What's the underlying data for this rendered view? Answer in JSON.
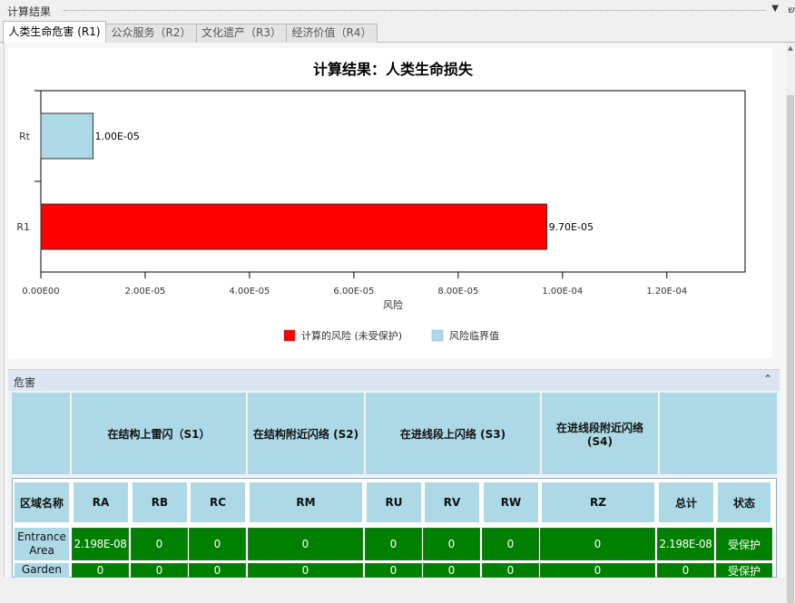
{
  "window": {
    "title": "计算结果"
  },
  "tabs": [
    {
      "label": "人类生命危害 (R1)",
      "active": true
    },
    {
      "label": "公众服务（R2）",
      "active": false
    },
    {
      "label": "文化遗产（R3）",
      "active": false
    },
    {
      "label": "经济价值（R4）",
      "active": false
    }
  ],
  "colors": {
    "calculated": "#ff0000",
    "tolerable": "#add8e6",
    "protected": "#008000",
    "header": "#add8e6"
  },
  "chart_data": {
    "type": "bar",
    "orientation": "horizontal",
    "title": "计算结果：人类生命损失",
    "xlabel": "风险",
    "ylabel": "",
    "categories": [
      "Rt",
      "R1"
    ],
    "bar_labels": [
      "1.00E-05",
      "9.70E-05"
    ],
    "xlim": [
      0,
      0.000135
    ],
    "xticks": [
      0,
      2e-05,
      4e-05,
      6e-05,
      8e-05,
      0.0001,
      0.00012
    ],
    "xtick_labels": [
      "0.00E00",
      "2.00E-05",
      "4.00E-05",
      "6.00E-05",
      "8.00E-05",
      "1.00E-04",
      "1.20E-04"
    ],
    "series": [
      {
        "name": "计算的风险 (未受保护)",
        "color": "#ff0000",
        "values": [
          null,
          9.7e-05
        ]
      },
      {
        "name": "风险临界值",
        "color": "#add8e6",
        "values": [
          1e-05,
          null
        ]
      }
    ],
    "grid": false,
    "legend": "bottom-center"
  },
  "hazard": {
    "title": "危害",
    "groups": [
      "在结构上雷闪（S1）",
      "在结构附近闪络 (S2)",
      "在进线段上闪络 (S3)",
      "在进线段附近闪络 (S4)"
    ],
    "columns": [
      "区域名称",
      "RA",
      "RB",
      "RC",
      "RM",
      "RU",
      "RV",
      "RW",
      "RZ",
      "总计",
      "状态"
    ],
    "rows": [
      {
        "name": "Entrance Area",
        "ra": "2.198E-08",
        "rb": "0",
        "rc": "0",
        "rm": "0",
        "ru": "0",
        "rv": "0",
        "rw": "0",
        "rz": "0",
        "total": "2.198E-08",
        "status": "受保护"
      },
      {
        "name": "Garden",
        "ra": "0",
        "rb": "0",
        "rc": "0",
        "rm": "0",
        "ru": "0",
        "rv": "0",
        "rw": "0",
        "rz": "0",
        "total": "0",
        "status": "受保护"
      }
    ]
  }
}
